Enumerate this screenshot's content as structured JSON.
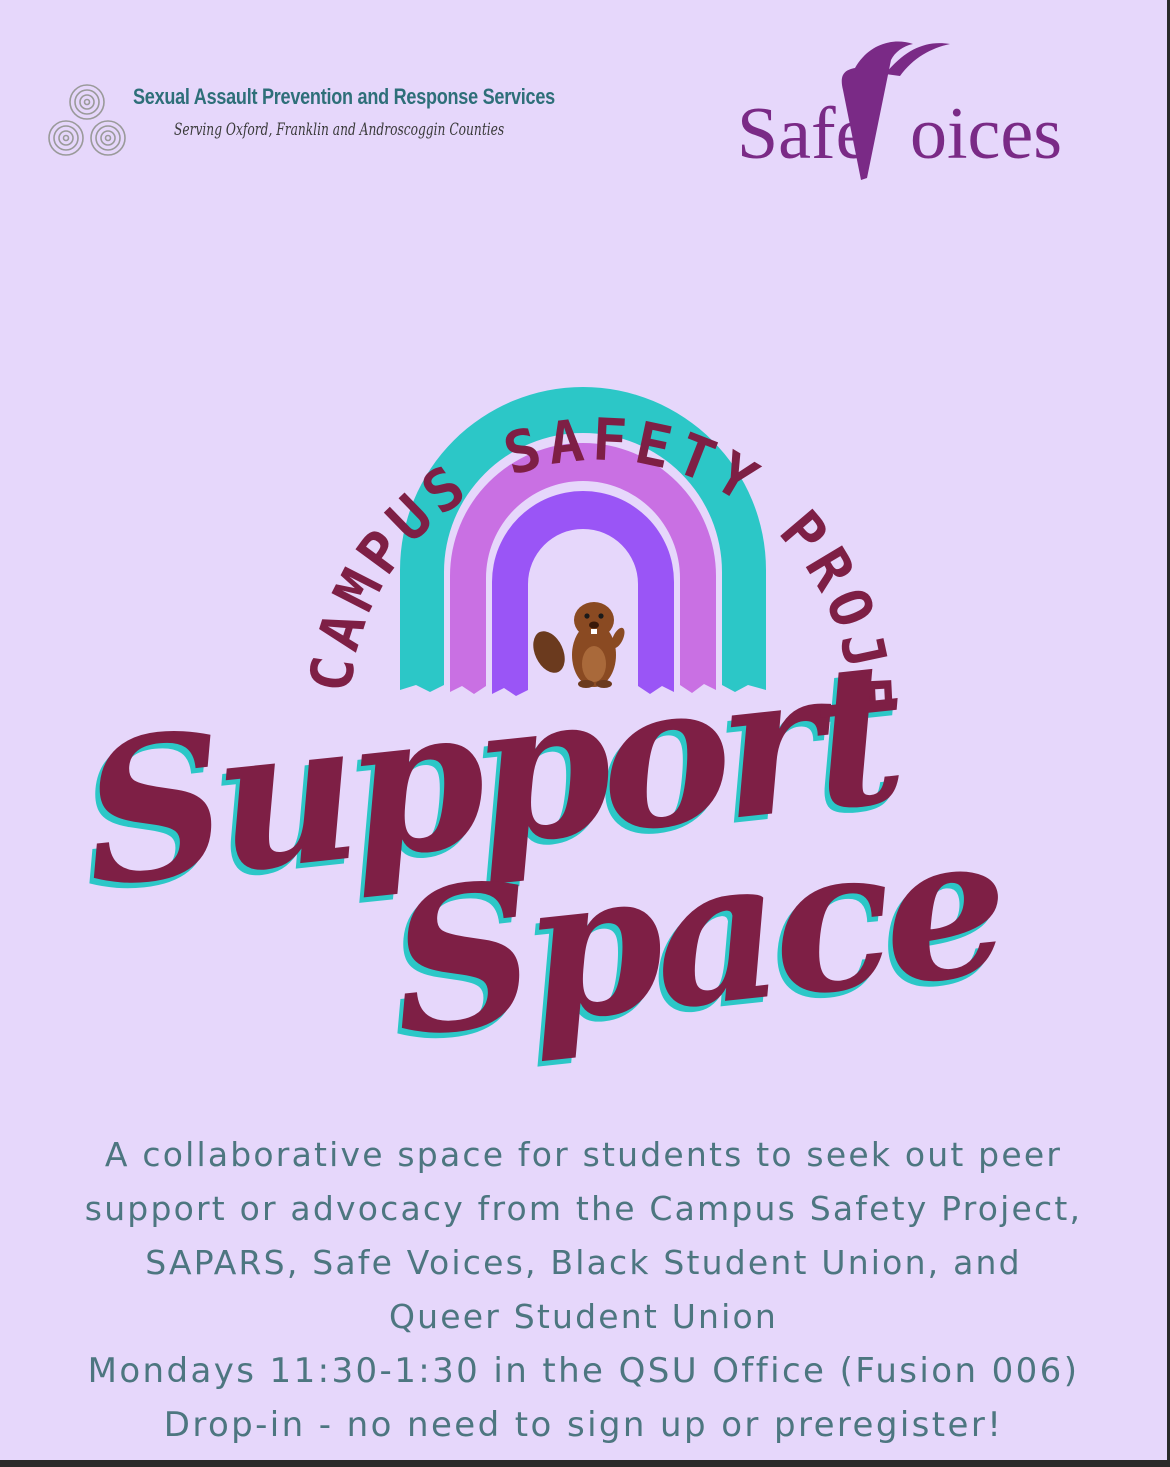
{
  "colors": {
    "background": "#e6d7fb",
    "maroon": "#7e1f45",
    "teal": "#2cc7c7",
    "pink_purple": "#c970e3",
    "violet": "#9a55f6",
    "safevoices_purple": "#7a2a86",
    "sapars_teal": "#2e6f79",
    "body_text": "#4d7680"
  },
  "header": {
    "sapars": {
      "icon": "triple-spiral-icon",
      "name": "Sexual Assault Prevention and Response Services",
      "tagline": "Serving Oxford, Franklin and Androscoggin Counties"
    },
    "safevoices": {
      "logo_text": "SafeVoices"
    }
  },
  "graphic": {
    "arc_text": "CAMPUS SAFETY PROJECT",
    "mascot_icon": "beaver-icon",
    "title_line_1": "Support",
    "title_line_2": "Space"
  },
  "details": {
    "description_lines": [
      "A collaborative space for students to seek out peer",
      "support or advocacy from the Campus Safety Project,",
      "SAPARS, Safe Voices, Black Student Union, and",
      "Queer Student Union"
    ],
    "schedule": "Mondays 11:30-1:30 in the QSU Office (Fusion 006)",
    "drop_in": "Drop-in - no need to sign up or preregister!"
  }
}
